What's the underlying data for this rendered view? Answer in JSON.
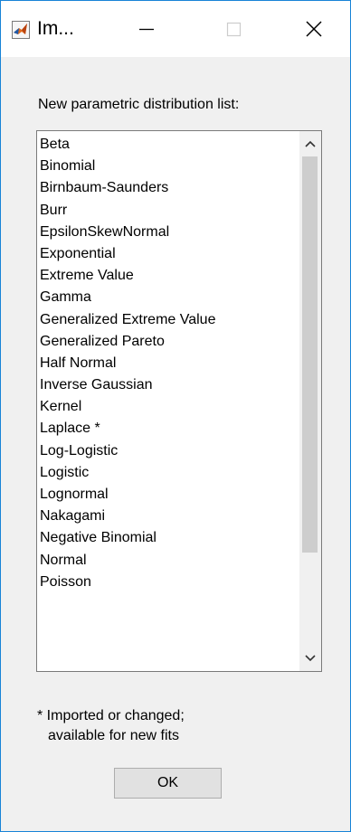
{
  "window": {
    "title": "Im...",
    "border_color": "#1883d7"
  },
  "titlebar": {
    "app_icon": "matlab-icon",
    "minimize_icon": "minimize-icon",
    "maximize_icon": "maximize-icon",
    "close_icon": "close-icon"
  },
  "heading": "New parametric distribution list:",
  "list": {
    "items": [
      "Beta",
      "Binomial",
      "Birnbaum-Saunders",
      "Burr",
      "EpsilonSkewNormal",
      "Exponential",
      "Extreme Value",
      "Gamma",
      "Generalized Extreme Value",
      "Generalized Pareto",
      "Half Normal",
      "Inverse Gaussian",
      "Kernel",
      "Laplace *",
      "Log-Logistic",
      "Logistic",
      "Lognormal",
      "Nakagami",
      "Negative Binomial",
      "Normal",
      "Poisson"
    ],
    "scroll_up_icon": "chevron-up-icon",
    "scroll_down_icon": "chevron-down-icon"
  },
  "footnote": {
    "line1": "* Imported or changed;",
    "line2": "available for new fits"
  },
  "ok_label": "OK"
}
